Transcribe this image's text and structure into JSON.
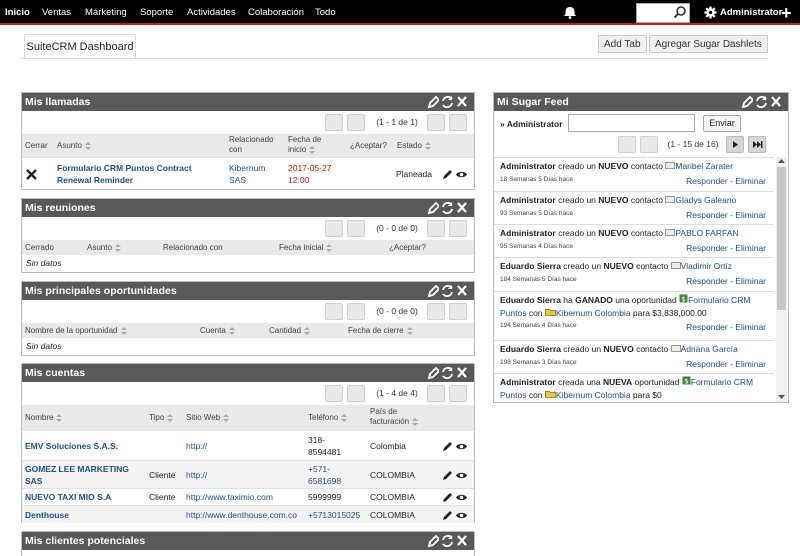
{
  "nav": {
    "items": [
      "Inicio",
      "Ventas",
      "Márketing",
      "Soporte",
      "Actividades",
      "Colaboración",
      "Todo"
    ],
    "user": "Administrator"
  },
  "dashboard": {
    "tab": "SuiteCRM Dashboard",
    "add_tab": "Add Tab",
    "add_dashlets": "Agregar Sugar Dashlets"
  },
  "calls": {
    "title": "Mis llamadas",
    "pagination": "(1 - 1 de 1)",
    "headers": [
      "Cerrar",
      "Asunto",
      "Relacionado con",
      "Fecha de inicio",
      "¿Aceptar?",
      "Estado"
    ],
    "rows": [
      {
        "subject": "Formulario CRM Puntos Contract Renewal Reminder",
        "subject_l1": "Formulario CRM Puntos Contract",
        "subject_l2": "Renewal Reminder",
        "related_l1": "Kibernum",
        "related_l2": "SAS",
        "date_l1": "2017-05-27",
        "date_l2": "12:00",
        "status": "Planeada"
      }
    ]
  },
  "meetings": {
    "title": "Mis reuniones",
    "pagination": "(0 - 0 de 0)",
    "headers": [
      "Cerrado",
      "Asunto",
      "Relacionado con",
      "Fecha inicial",
      "¿Aceptar?"
    ],
    "empty": "Sin datos"
  },
  "opportunities": {
    "title": "Mis principales oportunidades",
    "pagination": "(0 - 0 de 0)",
    "headers": [
      "Nombre de la oportunidad",
      "Cuenta",
      "Cantidad",
      "Fecha de cierre"
    ],
    "empty": "Sin datos"
  },
  "accounts": {
    "title": "Mis cuentas",
    "pagination": "(1 - 4 de 4)",
    "headers": [
      "Nombre",
      "Tipo",
      "Sitio Web",
      "Teléfono",
      "País de facturación"
    ],
    "rows": [
      {
        "name_l1": "EMV Soluciones S.A.S.",
        "name_l2": "",
        "type": "",
        "web": "http://",
        "phone_l1": "318-",
        "phone_l2": "8594481",
        "country": "Colombia"
      },
      {
        "name_l1": "GOMEZ LEE MARKETING",
        "name_l2": "SAS",
        "type": "Cliente",
        "web": "http://",
        "phone_l1": "+571-",
        "phone_l2": "6581698",
        "country": "COLOMBIA"
      },
      {
        "name_l1": "NUEVO TAXI MIO S.A",
        "name_l2": "",
        "type": "Cliente",
        "web": "http://www.taximio.com",
        "phone_l1": "5999999",
        "phone_l2": "",
        "country": "COLOMBIA"
      },
      {
        "name_l1": "Denthouse",
        "name_l2": "",
        "type": "",
        "web": "http://www.denthouse.com.co",
        "phone_l1": "+5713015025",
        "phone_l2": "",
        "country": "COLOMBIA"
      }
    ]
  },
  "leads": {
    "title": "Mis clientes potenciales"
  },
  "feed": {
    "title": "Mi Sugar Feed",
    "filter_label": "Administrator",
    "send": "Enviar",
    "pagination": "(1 - 15 de 16)",
    "reply": "Responder",
    "delete": "Eliminar",
    "items": [
      {
        "actor": "Administrator",
        "verb": " creado un ",
        "what": "NUEVO",
        "noun": " contacto ",
        "link": "Maribel Zarater",
        "link2": "",
        "extra": "",
        "time": "18 Semanas 5 Días hace"
      },
      {
        "actor": "Administrator",
        "verb": " creado un ",
        "what": "NUEVO",
        "noun": " contacto ",
        "link": "Gladys Galeano",
        "link2": "",
        "extra": "",
        "time": "93 Semanas 5 Días hace"
      },
      {
        "actor": "Administrator",
        "verb": " creado un ",
        "what": "NUEVO",
        "noun": " contacto ",
        "link": "PABLO FARFAN",
        "link2": "",
        "extra": "",
        "time": "95 Semanas 4 Días hace"
      },
      {
        "actor": "Eduardo Sierra",
        "verb": " creado un ",
        "what": "NUEVO",
        "noun": " contacto ",
        "link": "Vladimir Ortíz",
        "link2": "",
        "extra": "",
        "time": "184 Semanas 5 Días hace"
      },
      {
        "actor": "Eduardo Sierra",
        "verb": " ha ",
        "what": "GANADO",
        "noun": " una oportunidad ",
        "link": "Formulario CRM Puntos",
        "link2": "Kibernum Colombia",
        "extra": " para $3,838,000.00",
        "time": "194 Semanas 4 Días hace"
      },
      {
        "actor": "Eduardo Sierra",
        "verb": " creado un ",
        "what": "NUEVO",
        "noun": " contacto ",
        "link": "Adriana García",
        "link2": "",
        "extra": "",
        "time": "198 Semanas 3 Días hace"
      },
      {
        "actor": "Administrator",
        "verb": " creada una ",
        "what": "NUEVA",
        "noun": " oportunidad ",
        "link": "Formulario CRM Puntos",
        "link2": "Kibernum Colombia",
        "extra": " para $0",
        "time": ""
      }
    ]
  }
}
